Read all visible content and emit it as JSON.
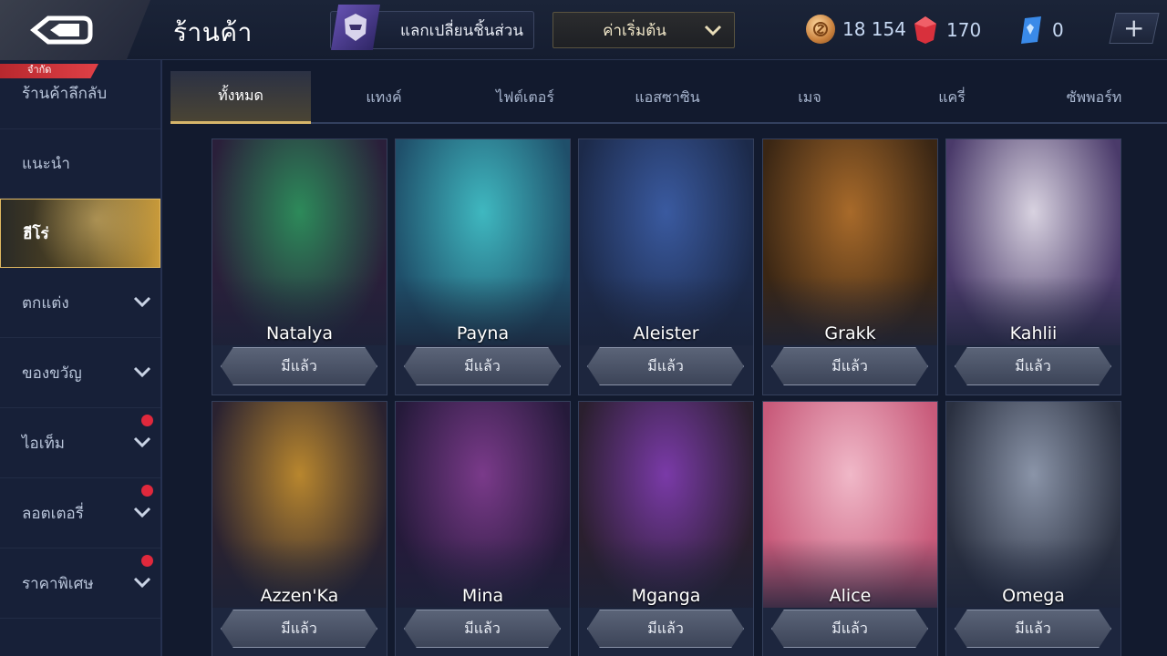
{
  "header": {
    "title": "ร้านค้า",
    "exchange_label": "แลกเปลี่ยนชิ้นส่วน",
    "sort": {
      "selected": "ค่าเริ่มต้น"
    },
    "currencies": [
      {
        "name": "gold",
        "value": "18 154"
      },
      {
        "name": "ruby",
        "value": "170"
      },
      {
        "name": "voucher",
        "value": "0"
      }
    ],
    "plus_label": "+"
  },
  "sidebar": {
    "badge": "จำกัด",
    "items": [
      {
        "label": "ร้านค้าลึกลับ"
      },
      {
        "label": "แนะนำ"
      },
      {
        "label": "ฮีโร่"
      },
      {
        "label": "ตกแต่ง"
      },
      {
        "label": "ของขวัญ"
      },
      {
        "label": "ไอเท็ม"
      },
      {
        "label": "ลอตเตอรี่"
      },
      {
        "label": "ราคาพิเศษ"
      }
    ]
  },
  "tabs": [
    {
      "label": "ทั้งหมด"
    },
    {
      "label": "แทงค์"
    },
    {
      "label": "ไฟต์เตอร์"
    },
    {
      "label": "แอสซาซิน"
    },
    {
      "label": "เมจ"
    },
    {
      "label": "แครี่"
    },
    {
      "label": "ซัพพอร์ท"
    }
  ],
  "heroes": [
    {
      "name": "Natalya",
      "status": "มีแล้ว",
      "color_a": "#2d8a5a",
      "color_b": "#2a1f3a"
    },
    {
      "name": "Payna",
      "status": "มีแล้ว",
      "color_a": "#3fb8c0",
      "color_b": "#1f4f6a"
    },
    {
      "name": "Aleister",
      "status": "มีแล้ว",
      "color_a": "#3a5aa0",
      "color_b": "#1c2a4a"
    },
    {
      "name": "Grakk",
      "status": "มีแล้ว",
      "color_a": "#a86a2a",
      "color_b": "#3a2614"
    },
    {
      "name": "Kahlii",
      "status": "มีแล้ว",
      "color_a": "#d8d2e0",
      "color_b": "#4a3a6a"
    },
    {
      "name": "Azzen'Ka",
      "status": "มีแล้ว",
      "color_a": "#b8862e",
      "color_b": "#2a2230"
    },
    {
      "name": "Mina",
      "status": "มีแล้ว",
      "color_a": "#7a3a8a",
      "color_b": "#251a3a"
    },
    {
      "name": "Mganga",
      "status": "มีแล้ว",
      "color_a": "#7a3aa8",
      "color_b": "#2a1f2e"
    },
    {
      "name": "Alice",
      "status": "มีแล้ว",
      "color_a": "#f0b8c8",
      "color_b": "#c85a7a"
    },
    {
      "name": "Omega",
      "status": "มีแล้ว",
      "color_a": "#8a94a8",
      "color_b": "#2a3040"
    }
  ]
}
